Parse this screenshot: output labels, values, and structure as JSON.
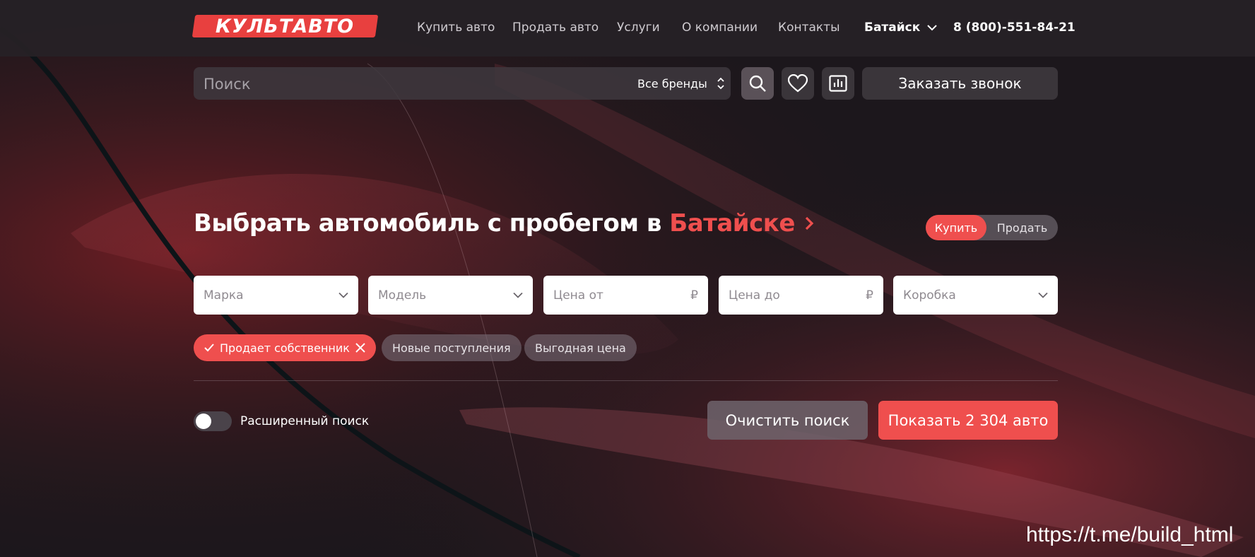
{
  "header": {
    "logo_text": "КУЛЬТАВТО",
    "nav": [
      {
        "label": "Купить авто"
      },
      {
        "label": "Продать авто"
      },
      {
        "label": "Услуги"
      },
      {
        "label": "О компании"
      },
      {
        "label": "Контакты"
      }
    ],
    "city": "Батайск",
    "phone": "8 (800)-551-84-21"
  },
  "search": {
    "placeholder": "Поиск",
    "brands_label": "Все бренды",
    "callback_label": "Заказать звонок"
  },
  "hero": {
    "title_prefix": "Выбрать автомобиль с пробегом в",
    "title_city": "Батайске",
    "mode_buy": "Купить",
    "mode_sell": "Продать"
  },
  "filters": [
    {
      "placeholder": "Марка",
      "icon": "chevron-down-icon"
    },
    {
      "placeholder": "Модель",
      "icon": "chevron-down-icon"
    },
    {
      "placeholder": "Цена от",
      "suffix": "₽"
    },
    {
      "placeholder": "Цена до",
      "suffix": "₽"
    },
    {
      "placeholder": "Коробка",
      "icon": "chevron-down-icon"
    }
  ],
  "chips": [
    {
      "label": "Продает собственник",
      "active": true
    },
    {
      "label": "Новые поступления",
      "active": false
    },
    {
      "label": "Выгодная цена",
      "active": false
    }
  ],
  "advanced_search_label": "Расширенный поиск",
  "actions": {
    "clear_label": "Очистить поиск",
    "show_label": "Показать 2 304 авто"
  },
  "watermark": "https://t.me/build_html",
  "colors": {
    "accent": "#ef4f4e",
    "background": "#1c171c"
  }
}
